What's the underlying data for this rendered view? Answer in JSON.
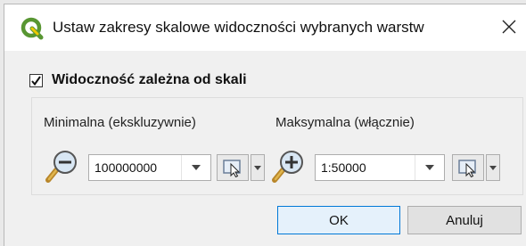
{
  "dialog": {
    "title": "Ustaw zakresy skalowe widoczności wybranych warstw",
    "close_symbol": "✕"
  },
  "scale_visibility": {
    "checked": true,
    "label": "Widoczność zależna od skali"
  },
  "minimum": {
    "label": "Minimalna (ekskluzywnie)",
    "value": "100000000",
    "icon": "zoom-out-icon"
  },
  "maximum": {
    "label": "Maksymalna (włącznie)",
    "value": "1:50000",
    "icon": "zoom-in-icon"
  },
  "buttons": {
    "ok": "OK",
    "cancel": "Anuluj"
  },
  "colors": {
    "accent": "#0078d7",
    "qgis_green": "#589632",
    "qgis_yellow": "#eec900"
  }
}
